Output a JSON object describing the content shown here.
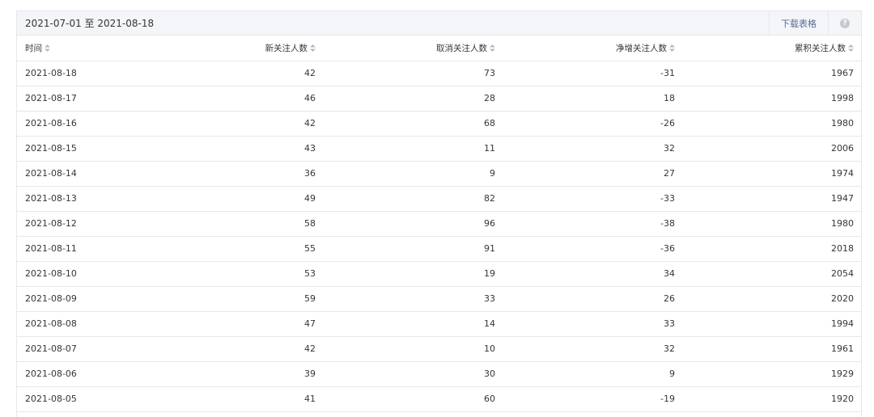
{
  "toolbar": {
    "date_range": "2021-07-01 至 2021-08-18",
    "download_label": "下载表格",
    "help_icon": "help-icon",
    "help_glyph": "?"
  },
  "table": {
    "columns": [
      {
        "key": "date",
        "label": "时间"
      },
      {
        "key": "new",
        "label": "新关注人数"
      },
      {
        "key": "cancel",
        "label": "取消关注人数"
      },
      {
        "key": "net",
        "label": "净增关注人数"
      },
      {
        "key": "total",
        "label": "累积关注人数"
      }
    ],
    "rows": [
      {
        "date": "2021-08-18",
        "new": "42",
        "cancel": "73",
        "net": "-31",
        "total": "1967"
      },
      {
        "date": "2021-08-17",
        "new": "46",
        "cancel": "28",
        "net": "18",
        "total": "1998"
      },
      {
        "date": "2021-08-16",
        "new": "42",
        "cancel": "68",
        "net": "-26",
        "total": "1980"
      },
      {
        "date": "2021-08-15",
        "new": "43",
        "cancel": "11",
        "net": "32",
        "total": "2006"
      },
      {
        "date": "2021-08-14",
        "new": "36",
        "cancel": "9",
        "net": "27",
        "total": "1974"
      },
      {
        "date": "2021-08-13",
        "new": "49",
        "cancel": "82",
        "net": "-33",
        "total": "1947"
      },
      {
        "date": "2021-08-12",
        "new": "58",
        "cancel": "96",
        "net": "-38",
        "total": "1980"
      },
      {
        "date": "2021-08-11",
        "new": "55",
        "cancel": "91",
        "net": "-36",
        "total": "2018"
      },
      {
        "date": "2021-08-10",
        "new": "53",
        "cancel": "19",
        "net": "34",
        "total": "2054"
      },
      {
        "date": "2021-08-09",
        "new": "59",
        "cancel": "33",
        "net": "26",
        "total": "2020"
      },
      {
        "date": "2021-08-08",
        "new": "47",
        "cancel": "14",
        "net": "33",
        "total": "1994"
      },
      {
        "date": "2021-08-07",
        "new": "42",
        "cancel": "10",
        "net": "32",
        "total": "1961"
      },
      {
        "date": "2021-08-06",
        "new": "39",
        "cancel": "30",
        "net": "9",
        "total": "1929"
      },
      {
        "date": "2021-08-05",
        "new": "41",
        "cancel": "60",
        "net": "-19",
        "total": "1920"
      },
      {
        "date": "",
        "new": "",
        "cancel": "",
        "net": "",
        "total": ""
      }
    ]
  },
  "colors": {
    "link": "#576b95",
    "border": "#e7e7eb",
    "header_bg": "#f4f5f9",
    "sort_icon": "#b7b9c0"
  }
}
